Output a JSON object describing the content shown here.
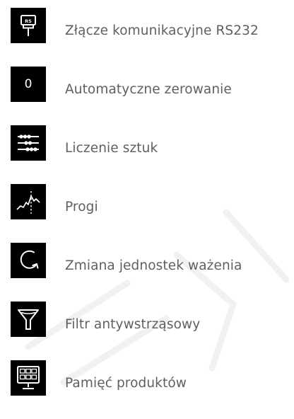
{
  "features": [
    {
      "icon": "rs232-connector-icon",
      "label": "Złącze komunikacyjne RS232"
    },
    {
      "icon": "zero-icon",
      "glyph": "0",
      "label": "Automatyczne zerowanie"
    },
    {
      "icon": "piece-counting-icon",
      "label": "Liczenie sztuk"
    },
    {
      "icon": "thresholds-icon",
      "label": "Progi"
    },
    {
      "icon": "unit-change-icon",
      "label": "Zmiana jednostek ważenia"
    },
    {
      "icon": "filter-icon",
      "label": "Filtr antywstrząsowy"
    },
    {
      "icon": "product-memory-icon",
      "label": "Pamięć produktów"
    }
  ],
  "colors": {
    "icon_background": "#000000",
    "icon_foreground": "#ffffff",
    "label_text": "#5f5f5f"
  }
}
